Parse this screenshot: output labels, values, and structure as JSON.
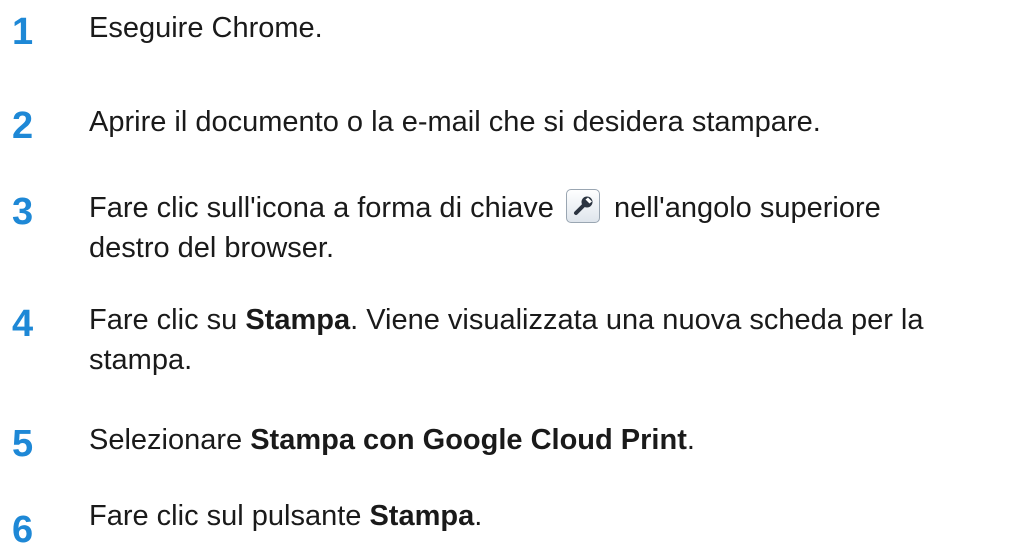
{
  "steps": [
    {
      "number": "1",
      "text": "Eseguire Chrome."
    },
    {
      "number": "2",
      "text": "Aprire il documento o la e-mail che si desidera stampare."
    },
    {
      "number": "3",
      "line1_before": "Fare clic sull'icona a forma di chiave",
      "line1_after": "nell'angolo superiore",
      "line2": "destro del browser.",
      "icon": "wrench-icon"
    },
    {
      "number": "4",
      "line1_before": "Fare clic su ",
      "bold": "Stampa",
      "line1_after": ". Viene visualizzata una nuova scheda per la",
      "line2": "stampa."
    },
    {
      "number": "5",
      "before": "Selezionare ",
      "bold": "Stampa con Google Cloud Print",
      "after": "."
    },
    {
      "number": "6",
      "before": "Fare clic sul pulsante ",
      "bold": "Stampa",
      "after": "."
    }
  ],
  "colors": {
    "step_number": "#1e88d6",
    "text": "#1a1a1a",
    "background": "#ffffff"
  }
}
